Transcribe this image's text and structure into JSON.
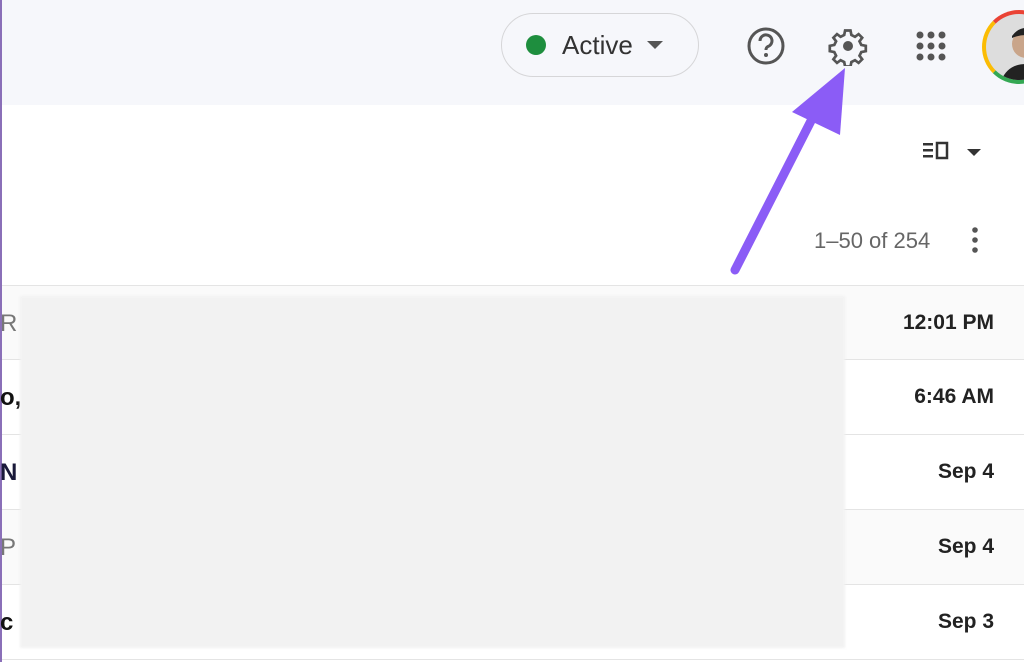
{
  "header": {
    "status": {
      "label": "Active",
      "color": "#1e8e3e"
    },
    "icons": [
      "help-icon",
      "settings-icon",
      "apps-grid-icon",
      "avatar"
    ]
  },
  "toolbar": {
    "pagination": "1–50 of 254"
  },
  "rows": [
    {
      "fragment": "R",
      "date": "12:01 PM",
      "unread": false
    },
    {
      "fragment": "o,",
      "date": "6:46 AM",
      "unread": true
    },
    {
      "fragment": "N",
      "date": "Sep 4",
      "unread": true
    },
    {
      "fragment": "P",
      "date": "Sep 4",
      "unread": false
    },
    {
      "fragment": "c",
      "date": "Sep 3",
      "unread": true
    }
  ],
  "annotation": {
    "arrow_color": "#8b5cf6",
    "points_to": "settings-icon"
  }
}
